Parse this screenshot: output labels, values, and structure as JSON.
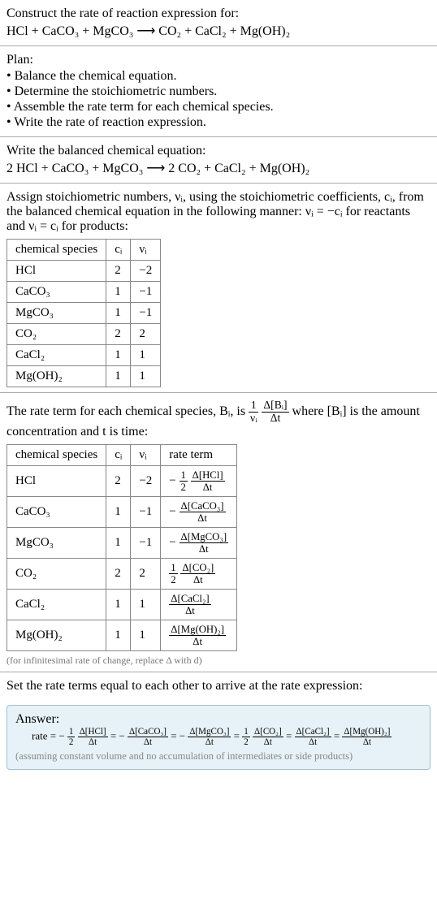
{
  "construct": {
    "title": "Construct the rate of reaction expression for:",
    "equation": "HCl + CaCO₃ + MgCO₃  ⟶  CO₂ + CaCl₂ + Mg(OH)₂"
  },
  "plan": {
    "title": "Plan:",
    "b1": "• Balance the chemical equation.",
    "b2": "• Determine the stoichiometric numbers.",
    "b3": "• Assemble the rate term for each chemical species.",
    "b4": "• Write the rate of reaction expression."
  },
  "balanced": {
    "title": "Write the balanced chemical equation:",
    "equation": "2 HCl + CaCO₃ + MgCO₃  ⟶  2 CO₂ + CaCl₂ + Mg(OH)₂"
  },
  "stoich": {
    "intro": "Assign stoichiometric numbers, νᵢ, using the stoichiometric coefficients, cᵢ, from the balanced chemical equation in the following manner: νᵢ = −cᵢ for reactants and νᵢ = cᵢ for products:",
    "h1": "chemical species",
    "h2": "cᵢ",
    "h3": "νᵢ",
    "rows": [
      {
        "sp": "HCl",
        "c": "2",
        "v": "−2"
      },
      {
        "sp": "CaCO₃",
        "c": "1",
        "v": "−1"
      },
      {
        "sp": "MgCO₃",
        "c": "1",
        "v": "−1"
      },
      {
        "sp": "CO₂",
        "c": "2",
        "v": "2"
      },
      {
        "sp": "CaCl₂",
        "c": "1",
        "v": "1"
      },
      {
        "sp": "Mg(OH)₂",
        "c": "1",
        "v": "1"
      }
    ]
  },
  "rateterm": {
    "pre": "The rate term for each chemical species, Bᵢ, is ",
    "frac1n": "1",
    "frac1d": "νᵢ",
    "frac2n": "Δ[Bᵢ]",
    "frac2d": "Δt",
    "mid": " where [Bᵢ] is the amount concentration and t is time:",
    "h1": "chemical species",
    "h2": "cᵢ",
    "h3": "νᵢ",
    "h4": "rate term",
    "note": "(for infinitesimal rate of change, replace Δ with d)",
    "rows": [
      {
        "sp": "HCl",
        "c": "2",
        "v": "−2",
        "neg": "−",
        "coef_n": "1",
        "coef_d": "2",
        "dn": "Δ[HCl]",
        "dd": "Δt"
      },
      {
        "sp": "CaCO₃",
        "c": "1",
        "v": "−1",
        "neg": "−",
        "coef_n": "",
        "coef_d": "",
        "dn": "Δ[CaCO₃]",
        "dd": "Δt"
      },
      {
        "sp": "MgCO₃",
        "c": "1",
        "v": "−1",
        "neg": "−",
        "coef_n": "",
        "coef_d": "",
        "dn": "Δ[MgCO₃]",
        "dd": "Δt"
      },
      {
        "sp": "CO₂",
        "c": "2",
        "v": "2",
        "neg": "",
        "coef_n": "1",
        "coef_d": "2",
        "dn": "Δ[CO₂]",
        "dd": "Δt"
      },
      {
        "sp": "CaCl₂",
        "c": "1",
        "v": "1",
        "neg": "",
        "coef_n": "",
        "coef_d": "",
        "dn": "Δ[CaCl₂]",
        "dd": "Δt"
      },
      {
        "sp": "Mg(OH)₂",
        "c": "1",
        "v": "1",
        "neg": "",
        "coef_n": "",
        "coef_d": "",
        "dn": "Δ[Mg(OH)₂]",
        "dd": "Δt"
      }
    ]
  },
  "final": {
    "title": "Set the rate terms equal to each other to arrive at the rate expression:"
  },
  "answer": {
    "label": "Answer:",
    "lead": "rate = ",
    "neg": "−",
    "half_n": "1",
    "half_d": "2",
    "t1n": "Δ[HCl]",
    "t1d": "Δt",
    "t2n": "Δ[CaCO₃]",
    "t2d": "Δt",
    "t3n": "Δ[MgCO₃]",
    "t3d": "Δt",
    "t4n": "Δ[CO₂]",
    "t4d": "Δt",
    "t5n": "Δ[CaCl₂]",
    "t5d": "Δt",
    "t6n": "Δ[Mg(OH)₂]",
    "t6d": "Δt",
    "eq": " = ",
    "assume": "(assuming constant volume and no accumulation of intermediates or side products)"
  }
}
